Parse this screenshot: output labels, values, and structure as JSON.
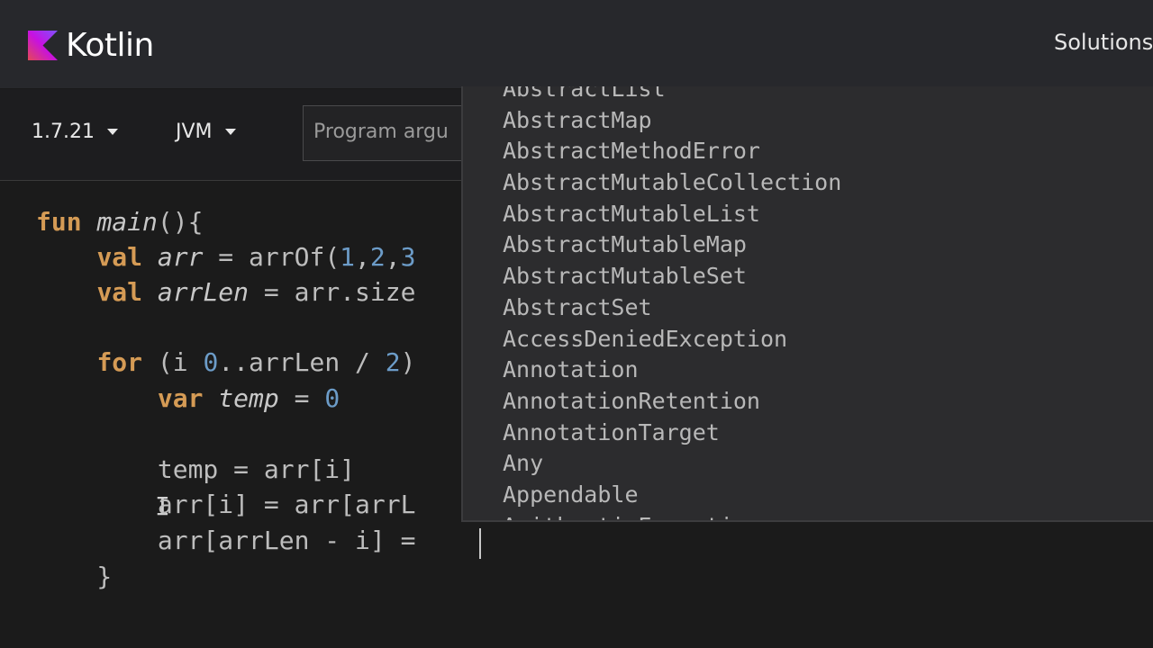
{
  "header": {
    "brand": "Kotlin",
    "nav_solutions": "Solutions",
    "brand_color": "#7f52ff"
  },
  "toolbar": {
    "version": "1.7.21",
    "platform": "JVM",
    "args_placeholder": "Program argu"
  },
  "editor": {
    "cursor_glyph": "I",
    "lines": [
      [
        {
          "t": "fun",
          "c": "kw"
        },
        {
          "t": " ",
          "c": "plain"
        },
        {
          "t": "main",
          "c": "fn"
        },
        {
          "t": "(){",
          "c": "plain"
        }
      ],
      [
        {
          "t": "    ",
          "c": "plain"
        },
        {
          "t": "val",
          "c": "kw"
        },
        {
          "t": " ",
          "c": "plain"
        },
        {
          "t": "arr",
          "c": "var"
        },
        {
          "t": " = arrOf(",
          "c": "plain"
        },
        {
          "t": "1",
          "c": "num"
        },
        {
          "t": ",",
          "c": "plain"
        },
        {
          "t": "2",
          "c": "num"
        },
        {
          "t": ",",
          "c": "plain"
        },
        {
          "t": "3",
          "c": "num"
        }
      ],
      [
        {
          "t": "    ",
          "c": "plain"
        },
        {
          "t": "val",
          "c": "kw"
        },
        {
          "t": " ",
          "c": "plain"
        },
        {
          "t": "arrLen",
          "c": "var"
        },
        {
          "t": " = arr.size",
          "c": "plain"
        }
      ],
      [],
      [
        {
          "t": "    ",
          "c": "plain"
        },
        {
          "t": "for",
          "c": "kw"
        },
        {
          "t": " (i ",
          "c": "plain"
        },
        {
          "t": "0",
          "c": "num"
        },
        {
          "t": "..arrLen / ",
          "c": "plain"
        },
        {
          "t": "2",
          "c": "num"
        },
        {
          "t": ")",
          "c": "plain"
        }
      ],
      [
        {
          "t": "        ",
          "c": "plain"
        },
        {
          "t": "var",
          "c": "kw"
        },
        {
          "t": " ",
          "c": "plain"
        },
        {
          "t": "temp",
          "c": "var"
        },
        {
          "t": " = ",
          "c": "plain"
        },
        {
          "t": "0",
          "c": "num"
        }
      ],
      [],
      [
        {
          "t": "        temp = arr[i]",
          "c": "plain"
        }
      ],
      [
        {
          "t": "        arr[i] = arr[arrL",
          "c": "plain"
        }
      ],
      [
        {
          "t": "        arr[arrLen - i] = ",
          "c": "plain"
        }
      ],
      [
        {
          "t": "    }",
          "c": "plain"
        }
      ]
    ]
  },
  "autocomplete": {
    "items": [
      "AbstractList",
      "AbstractMap",
      "AbstractMethodError",
      "AbstractMutableCollection",
      "AbstractMutableList",
      "AbstractMutableMap",
      "AbstractMutableSet",
      "AbstractSet",
      "AccessDeniedException",
      "Annotation",
      "AnnotationRetention",
      "AnnotationTarget",
      "Any",
      "Appendable",
      "ArithmeticException"
    ]
  }
}
